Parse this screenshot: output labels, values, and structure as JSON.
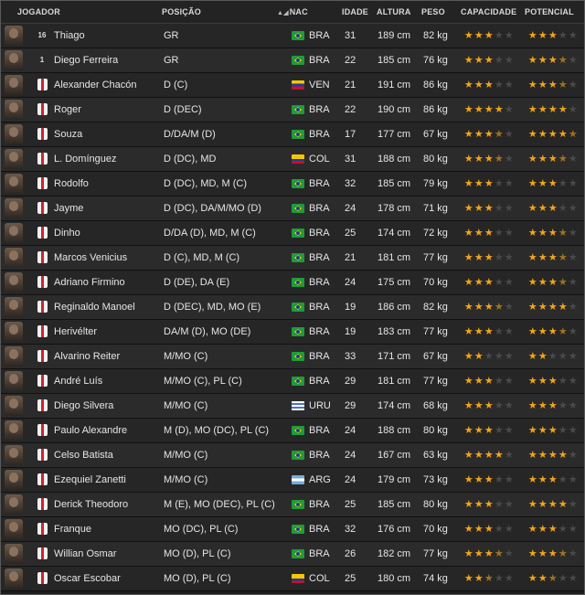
{
  "columns": {
    "jogador": "JOGADOR",
    "posicao": "POSIÇÃO",
    "nac": "NAC",
    "idade": "IDADE",
    "altura": "ALTURA",
    "peso": "PESO",
    "capacidade": "CAPACIDADE",
    "potencial": "POTENCIAL"
  },
  "colors": {
    "star": "#f2a51a",
    "star_empty": "#4a4a4a",
    "row_odd": "#262626",
    "row_even": "#2b2b2b"
  },
  "players": [
    {
      "num": "16",
      "name": "Thiago",
      "pos": "GR",
      "nat": "BRA",
      "age": "31",
      "height": "189 cm",
      "weight": "82 kg",
      "cap": 3,
      "pot": 3
    },
    {
      "num": "1",
      "name": "Diego Ferreira",
      "pos": "GR",
      "nat": "BRA",
      "age": "22",
      "height": "185 cm",
      "weight": "76 kg",
      "cap": 3,
      "pot": 3.5
    },
    {
      "num": "",
      "name": "Alexander Chacón",
      "pos": "D (C)",
      "nat": "VEN",
      "age": "21",
      "height": "191 cm",
      "weight": "86 kg",
      "cap": 3,
      "pot": 3.5
    },
    {
      "num": "",
      "name": "Roger",
      "pos": "D (DEC)",
      "nat": "BRA",
      "age": "22",
      "height": "190 cm",
      "weight": "86 kg",
      "cap": 4,
      "pot": 4
    },
    {
      "num": "",
      "name": "Souza",
      "pos": "D/DA/M (D)",
      "nat": "BRA",
      "age": "17",
      "height": "177 cm",
      "weight": "67 kg",
      "cap": 3.5,
      "pot": 4.5
    },
    {
      "num": "",
      "name": "L. Domínguez",
      "pos": "D (DC), MD",
      "nat": "COL",
      "age": "31",
      "height": "188 cm",
      "weight": "80 kg",
      "cap": 3.5,
      "pot": 3.5
    },
    {
      "num": "",
      "name": "Rodolfo",
      "pos": "D (DC), MD, M (C)",
      "nat": "BRA",
      "age": "32",
      "height": "185 cm",
      "weight": "79 kg",
      "cap": 3,
      "pot": 3
    },
    {
      "num": "",
      "name": "Jayme",
      "pos": "D (DC), DA/M/MO (D)",
      "nat": "BRA",
      "age": "24",
      "height": "178 cm",
      "weight": "71 kg",
      "cap": 3,
      "pot": 3
    },
    {
      "num": "",
      "name": "Dinho",
      "pos": "D/DA (D), MD, M (C)",
      "nat": "BRA",
      "age": "25",
      "height": "174 cm",
      "weight": "72 kg",
      "cap": 3,
      "pot": 3.5
    },
    {
      "num": "",
      "name": "Marcos Venicius",
      "pos": "D (C), MD, M (C)",
      "nat": "BRA",
      "age": "21",
      "height": "181 cm",
      "weight": "77 kg",
      "cap": 3,
      "pot": 3.5
    },
    {
      "num": "",
      "name": "Adriano Firmino",
      "pos": "D (DE), DA (E)",
      "nat": "BRA",
      "age": "24",
      "height": "175 cm",
      "weight": "70 kg",
      "cap": 3,
      "pot": 3.5
    },
    {
      "num": "",
      "name": "Reginaldo Manoel",
      "pos": "D (DEC), MD, MO (E)",
      "nat": "BRA",
      "age": "19",
      "height": "186 cm",
      "weight": "82 kg",
      "cap": 3.5,
      "pot": 4
    },
    {
      "num": "",
      "name": "Herivélter",
      "pos": "DA/M (D), MO (DE)",
      "nat": "BRA",
      "age": "19",
      "height": "183 cm",
      "weight": "77 kg",
      "cap": 3,
      "pot": 3.5
    },
    {
      "num": "",
      "name": "Alvarino Reiter",
      "pos": "M/MO (C)",
      "nat": "BRA",
      "age": "33",
      "height": "171 cm",
      "weight": "67 kg",
      "cap": 2,
      "pot": 2
    },
    {
      "num": "",
      "name": "André Luís",
      "pos": "M/MO (C), PL (C)",
      "nat": "BRA",
      "age": "29",
      "height": "181 cm",
      "weight": "77 kg",
      "cap": 3,
      "pot": 3
    },
    {
      "num": "",
      "name": "Diego Silvera",
      "pos": "M/MO (C)",
      "nat": "URU",
      "age": "29",
      "height": "174 cm",
      "weight": "68 kg",
      "cap": 3,
      "pot": 3
    },
    {
      "num": "",
      "name": "Paulo Alexandre",
      "pos": "M (D), MO (DC), PL (C)",
      "nat": "BRA",
      "age": "24",
      "height": "188 cm",
      "weight": "80 kg",
      "cap": 3,
      "pot": 3
    },
    {
      "num": "",
      "name": "Celso Batista",
      "pos": "M/MO (C)",
      "nat": "BRA",
      "age": "24",
      "height": "167 cm",
      "weight": "63 kg",
      "cap": 4,
      "pot": 4
    },
    {
      "num": "",
      "name": "Ezequiel Zanetti",
      "pos": "M/MO (C)",
      "nat": "ARG",
      "age": "24",
      "height": "179 cm",
      "weight": "73 kg",
      "cap": 3,
      "pot": 3
    },
    {
      "num": "",
      "name": "Derick Theodoro",
      "pos": "M (E), MO (DEC), PL (C)",
      "nat": "BRA",
      "age": "25",
      "height": "185 cm",
      "weight": "80 kg",
      "cap": 3,
      "pot": 4
    },
    {
      "num": "",
      "name": "Franque",
      "pos": "MO (DC), PL (C)",
      "nat": "BRA",
      "age": "32",
      "height": "176 cm",
      "weight": "70 kg",
      "cap": 3,
      "pot": 3
    },
    {
      "num": "",
      "name": "Willian Osmar",
      "pos": "MO (D), PL (C)",
      "nat": "BRA",
      "age": "26",
      "height": "182 cm",
      "weight": "77 kg",
      "cap": 3.5,
      "pot": 3.5
    },
    {
      "num": "",
      "name": "Oscar Escobar",
      "pos": "MO (D), PL (C)",
      "nat": "COL",
      "age": "25",
      "height": "180 cm",
      "weight": "74 kg",
      "cap": 2.5,
      "pot": 2.5
    }
  ]
}
